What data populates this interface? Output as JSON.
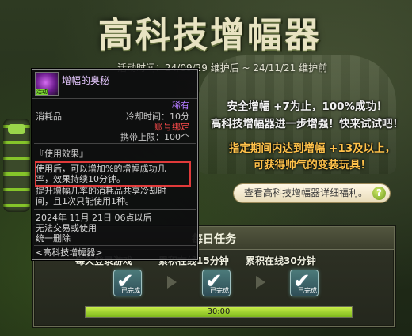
{
  "banner": {
    "title": "高科技增幅器",
    "event_time": "活动时间：24/09/29 维护后 ~ 24/11/21 维护前"
  },
  "promo": {
    "line1": "安全增幅 +7为止，100%成功！",
    "line2": "高科技增幅器进一步增强！快来试试吧！",
    "line3": "指定期间内达到增幅 +13及以上，",
    "line4": "可获得帅气的变装玩具！"
  },
  "detail_button": {
    "label": "查看高科技增幅器详细福利。",
    "help": "?"
  },
  "daily": {
    "title": "每日任务",
    "missions": [
      {
        "label": "每天登录游戏",
        "check_sub": "已完成"
      },
      {
        "label": "累积在线15分钟",
        "check_sub": "已完成"
      },
      {
        "label": "累积在线30分钟",
        "check_sub": "已完成"
      }
    ],
    "progress_text": "30:00",
    "progress_fraction": 1.0
  },
  "tooltip": {
    "item_name": "增幅的奥秘",
    "icon_tag": "活动",
    "rarity": "稀有",
    "type": "消耗品",
    "cooldown": "冷却时间：10分",
    "bind": "账号绑定",
    "carry_limit": "携带上限：100个",
    "effect_header": "『使用效果』",
    "effect_line1": "使用后，可以增加%的增幅成功几",
    "effect_line2": "率，效果持续10分钟。",
    "effect_line3": "提升增幅几率的消耗品共享冷却时",
    "effect_line4": "间，且1次只能使用1种。",
    "expire_line1": "2024年 11月 21日 06点以后",
    "expire_line2": "无法交易或使用",
    "expire_line3": "统一删除",
    "footer": "<高科技增幅器>"
  },
  "colors": {
    "accent_green": "#7fb81d",
    "promo_gold": "#ffc24a",
    "rarity_purple": "#b37bff",
    "bind_red": "#ff4c4c",
    "highlight_red": "#e03a3a"
  }
}
